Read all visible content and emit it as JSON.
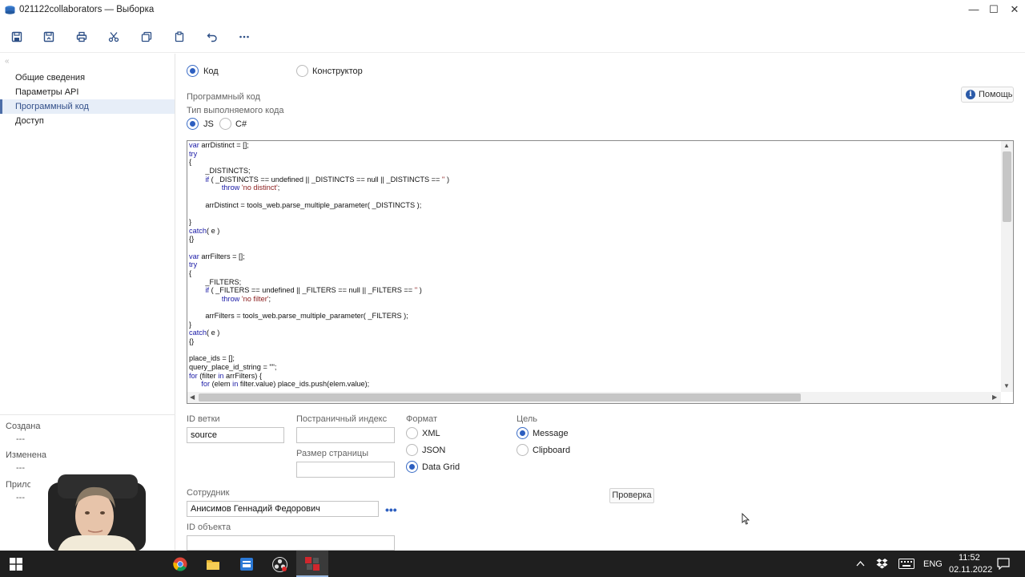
{
  "window": {
    "title": "021122collaborators — Выборка",
    "controls": [
      "minimize",
      "maximize",
      "close"
    ]
  },
  "toolbar": {
    "buttons": [
      {
        "icon": "save-icon"
      },
      {
        "icon": "save-as-icon"
      },
      {
        "icon": "print-icon"
      },
      {
        "icon": "cut-icon"
      },
      {
        "icon": "copy-icon"
      },
      {
        "icon": "paste-icon"
      },
      {
        "icon": "undo-icon"
      },
      {
        "icon": "more-icon"
      }
    ]
  },
  "sidebar": {
    "collapse_glyph": "«",
    "items": [
      {
        "label": "Общие сведения",
        "active": false
      },
      {
        "label": "Параметры API",
        "active": false
      },
      {
        "label": "Программный код",
        "active": true
      },
      {
        "label": "Доступ",
        "active": false
      }
    ],
    "meta": [
      {
        "label": "Создана",
        "value": "---"
      },
      {
        "label": "Изменена",
        "value": "---"
      },
      {
        "label": "Приложения",
        "value": "---"
      }
    ]
  },
  "mode": {
    "options": [
      "Код",
      "Конструктор"
    ],
    "selected": "Код"
  },
  "program_code": {
    "section_label": "Программный код",
    "help_label": "Помощь",
    "exec_type_label": "Тип выполняемого кода",
    "exec_options": [
      "JS",
      "C#"
    ],
    "exec_selected": "JS"
  },
  "editor": {
    "code": "var arrDistinct = [];\ntry\n{\n        _DISTINCTS;\n        if ( _DISTINCTS == undefined || _DISTINCTS == null || _DISTINCTS == '' )\n                throw 'no distinct';\n\n        arrDistinct = tools_web.parse_multiple_parameter( _DISTINCTS );\n\n}\ncatch( e )\n{}\n\nvar arrFilters = [];\ntry\n{\n        _FILTERS;\n        if ( _FILTERS == undefined || _FILTERS == null || _FILTERS == '' )\n                throw 'no filter';\n\n        arrFilters = tools_web.parse_multiple_parameter( _FILTERS );\n}\ncatch( e )\n{}\n\nplace_ids = [];\nquery_place_id_string = \"\";\nfor (filter in arrFilters) {\n      for (elem in filter.value) place_ids.push(elem.value);"
  },
  "form": {
    "branch_id_label": "ID ветки",
    "branch_id_value": "source",
    "page_index_label": "Постраничный индекс",
    "page_index_value": "",
    "page_size_label": "Размер страницы",
    "page_size_value": "",
    "format_label": "Формат",
    "format_options": [
      "XML",
      "JSON",
      "Data Grid"
    ],
    "format_selected": "Data Grid",
    "target_label": "Цель",
    "target_options": [
      "Message",
      "Clipboard"
    ],
    "target_selected": "Message",
    "employee_label": "Сотрудник",
    "employee_value": "Анисимов Геннадий Федорович",
    "employee_more": "•••",
    "object_id_label": "ID объекта",
    "object_id_value": "",
    "check_button": "Проверка"
  },
  "taskbar": {
    "apps": [
      "windows-start-icon",
      "chrome-icon",
      "file-explorer-icon",
      "app-icon",
      "obs-icon",
      "app-red-icon"
    ],
    "language": "ENG",
    "time": "11:52",
    "date": "02.11.2022"
  }
}
